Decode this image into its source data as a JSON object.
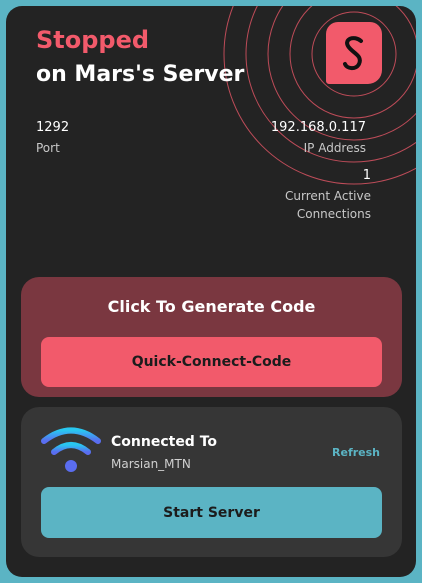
{
  "header": {
    "status": "Stopped",
    "server_name": "on Mars's Server"
  },
  "stats": {
    "port_value": "1292",
    "port_label": "Port",
    "ip_value": "192.168.0.117",
    "ip_label": "IP Address",
    "connections_value": "1",
    "connections_label_line1": "Current Active",
    "connections_label_line2": "Connections"
  },
  "generate": {
    "title": "Click To Generate Code",
    "button_label": "Quick-Connect-Code"
  },
  "network": {
    "title": "Connected To",
    "ssid": "Marsian_MTN",
    "refresh_label": "Refresh",
    "start_button_label": "Start Server"
  },
  "colors": {
    "accent_red": "#f25a6b",
    "accent_teal": "#5bb4c4",
    "card_bg": "#232323",
    "panel_bg": "#363636",
    "generate_panel_bg": "#7a3740"
  },
  "icons": {
    "logo": "s-logo-icon",
    "wifi": "wifi-icon"
  }
}
